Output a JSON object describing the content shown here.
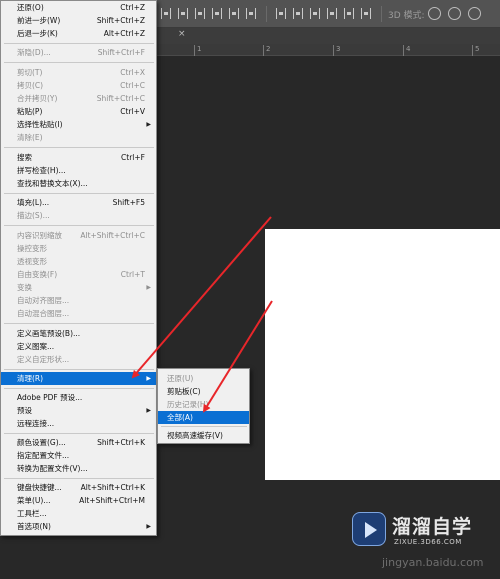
{
  "toolbar": {
    "mode_3d_label": "3D 模式:"
  },
  "ruler": {
    "ticks": [
      "1",
      "2",
      "3",
      "4",
      "5"
    ]
  },
  "edit_menu": {
    "items": [
      {
        "label": "还原(O)",
        "shortcut": "Ctrl+Z"
      },
      {
        "label": "前进一步(W)",
        "shortcut": "Shift+Ctrl+Z"
      },
      {
        "label": "后退一步(K)",
        "shortcut": "Alt+Ctrl+Z"
      },
      {
        "label": "渐隐(D)...",
        "shortcut": "Shift+Ctrl+F"
      },
      {
        "label": "剪切(T)",
        "shortcut": "Ctrl+X"
      },
      {
        "label": "拷贝(C)",
        "shortcut": "Ctrl+C"
      },
      {
        "label": "合并拷贝(Y)",
        "shortcut": "Shift+Ctrl+C"
      },
      {
        "label": "粘贴(P)",
        "shortcut": "Ctrl+V"
      },
      {
        "label": "选择性粘贴(I)",
        "shortcut": ""
      },
      {
        "label": "清除(E)",
        "shortcut": ""
      },
      {
        "label": "搜索",
        "shortcut": "Ctrl+F"
      },
      {
        "label": "拼写检查(H)...",
        "shortcut": ""
      },
      {
        "label": "查找和替换文本(X)...",
        "shortcut": ""
      },
      {
        "label": "填充(L)...",
        "shortcut": "Shift+F5"
      },
      {
        "label": "描边(S)...",
        "shortcut": ""
      },
      {
        "label": "内容识别缩放",
        "shortcut": "Alt+Shift+Ctrl+C"
      },
      {
        "label": "操控变形",
        "shortcut": ""
      },
      {
        "label": "透视变形",
        "shortcut": ""
      },
      {
        "label": "自由变换(F)",
        "shortcut": "Ctrl+T"
      },
      {
        "label": "变换",
        "shortcut": ""
      },
      {
        "label": "自动对齐图层...",
        "shortcut": ""
      },
      {
        "label": "自动混合图层...",
        "shortcut": ""
      },
      {
        "label": "定义画笔预设(B)...",
        "shortcut": ""
      },
      {
        "label": "定义图案...",
        "shortcut": ""
      },
      {
        "label": "定义自定形状...",
        "shortcut": ""
      },
      {
        "label": "清理(R)",
        "shortcut": ""
      },
      {
        "label": "Adobe PDF 预设...",
        "shortcut": ""
      },
      {
        "label": "预设",
        "shortcut": ""
      },
      {
        "label": "远程连接...",
        "shortcut": ""
      },
      {
        "label": "颜色设置(G)...",
        "shortcut": "Shift+Ctrl+K"
      },
      {
        "label": "指定配置文件...",
        "shortcut": ""
      },
      {
        "label": "转换为配置文件(V)...",
        "shortcut": ""
      },
      {
        "label": "键盘快捷键...",
        "shortcut": "Alt+Shift+Ctrl+K"
      },
      {
        "label": "菜单(U)...",
        "shortcut": "Alt+Shift+Ctrl+M"
      },
      {
        "label": "工具栏...",
        "shortcut": ""
      },
      {
        "label": "首选项(N)",
        "shortcut": ""
      }
    ]
  },
  "purge_submenu": {
    "items": [
      {
        "label": "还原(U)"
      },
      {
        "label": "剪贴板(C)"
      },
      {
        "label": "历史记录(H)"
      },
      {
        "label": "全部(A)"
      },
      {
        "label": "视频高速缓存(V)"
      }
    ]
  },
  "watermark": {
    "title": "溜溜自学",
    "url": "ZIXUE.3D66.COM",
    "bottom_text": "jingyan.baidu.com"
  },
  "colors": {
    "highlight": "#0a6fd3",
    "menu_bg": "#f0f0f0",
    "arrow": "#e8262a",
    "canvas": "#ffffff",
    "workspace": "#282828"
  }
}
